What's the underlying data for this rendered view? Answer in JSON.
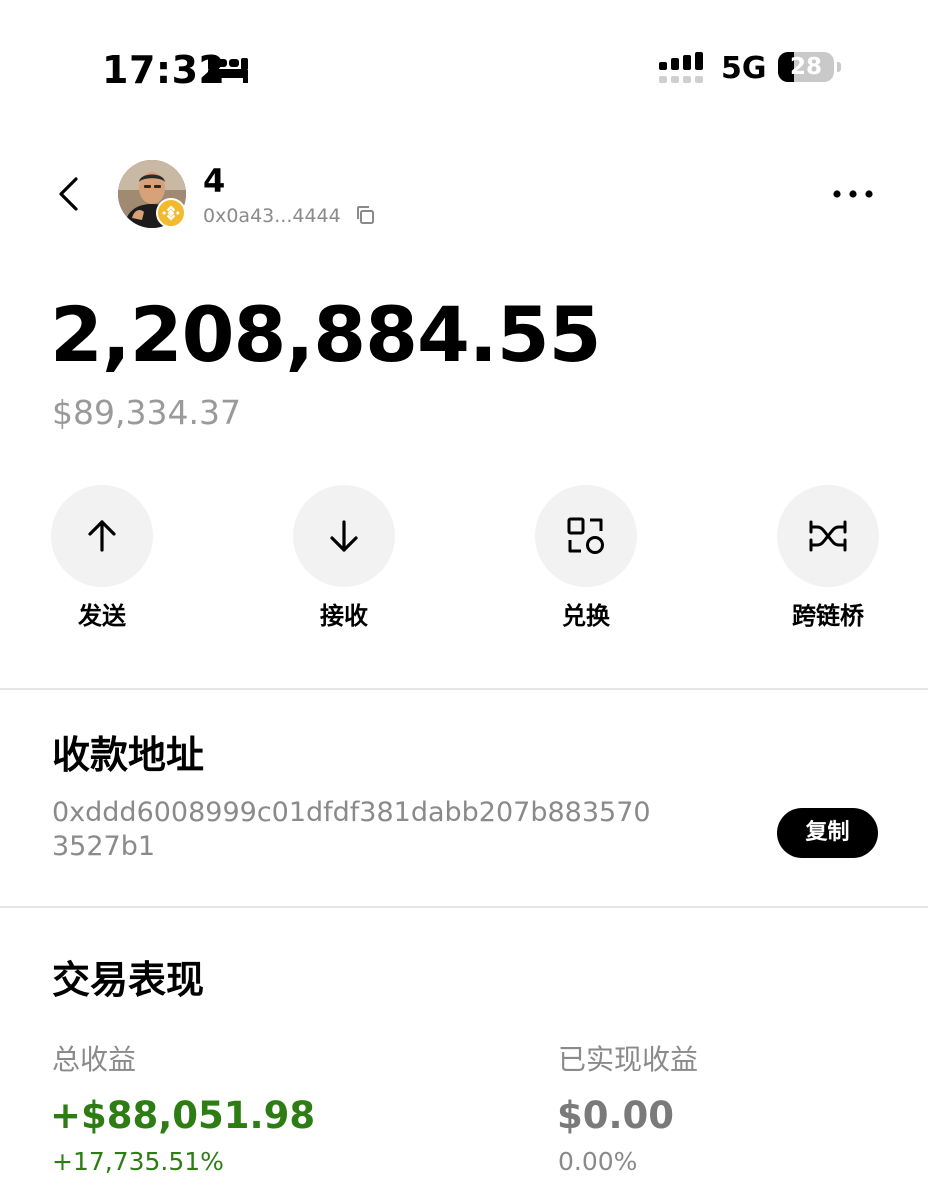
{
  "status_bar": {
    "time": "17:32",
    "sleep_icon": "bed-icon",
    "signal_icon": "cellular-signal-icon",
    "network": "5G",
    "battery_level": "28",
    "battery_fraction": 0.28
  },
  "header": {
    "back_icon": "chevron-left-icon",
    "avatar": "profile-photo",
    "badge_icon": "bnb-chain-icon",
    "wallet_name": "4",
    "address_short": "0x0a43...4444",
    "copy_icon": "copy-icon",
    "more_icon": "more-dots-icon"
  },
  "balance": {
    "amount": "2,208,884.55",
    "usd_value": "$89,334.37"
  },
  "actions": [
    {
      "label": "发送",
      "icon": "arrow-up-icon"
    },
    {
      "label": "接收",
      "icon": "arrow-down-icon"
    },
    {
      "label": "兑换",
      "icon": "swap-icon"
    },
    {
      "label": "跨链桥",
      "icon": "bridge-icon"
    }
  ],
  "receive": {
    "title": "收款地址",
    "address": "0xddd6008999c01dfdf381dabb207b8835703527b1",
    "copy_label": "复制"
  },
  "performance": {
    "title": "交易表现",
    "total_pnl_label": "总收益",
    "total_pnl_value": "+$88,051.98",
    "total_pnl_percent": "+17,735.51%",
    "realized_label": "已实现收益",
    "realized_value": "$0.00",
    "realized_percent": "0.00%"
  },
  "colors": {
    "positive": "#2e7d14",
    "muted": "#8a8a8a",
    "action_bg": "#f2f2f2",
    "divider": "#e6e6e6"
  }
}
